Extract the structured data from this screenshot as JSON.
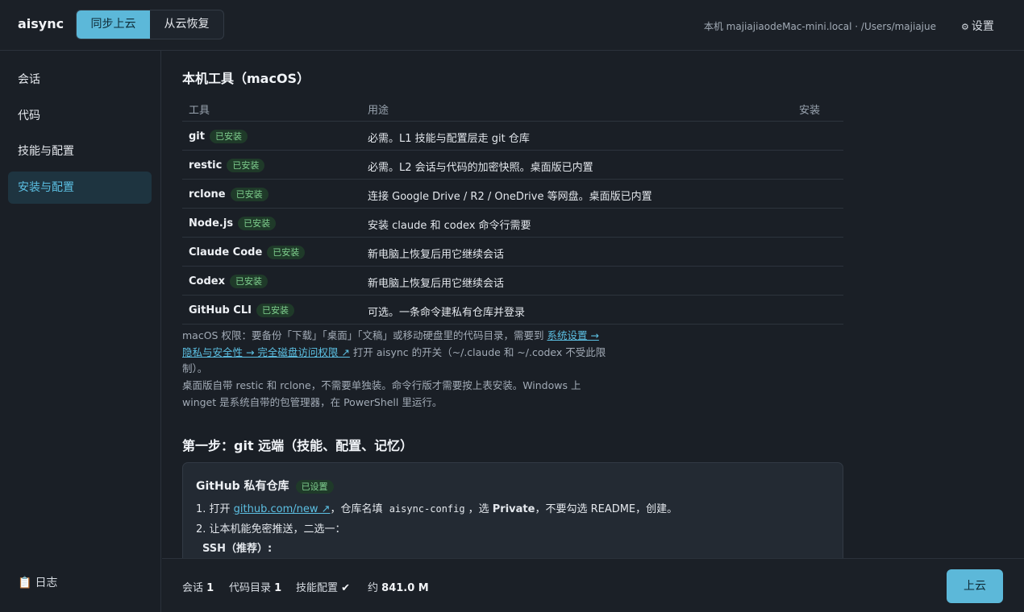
{
  "header": {
    "logo": "aisync",
    "tabs": [
      "同步上云",
      "从云恢复"
    ],
    "machine": "本机 majiajiaodeMac-mini.local · /Users/majiajue",
    "settings_icon": "⚙",
    "settings_label": "设置"
  },
  "sidebar": {
    "items": [
      "会话",
      "代码",
      "技能与配置",
      "安装与配置"
    ],
    "log_icon": "📋",
    "log_label": "日志"
  },
  "main": {
    "section1_title": "本机工具（macOS）",
    "table": {
      "headers": [
        "工具",
        "用途",
        "安装"
      ],
      "badge": "已安装",
      "rows": [
        {
          "name": "git",
          "desc": "必需。L1 技能与配置层走 git 仓库"
        },
        {
          "name": "restic",
          "desc": "必需。L2 会话与代码的加密快照。桌面版已内置"
        },
        {
          "name": "rclone",
          "desc": "连接 Google Drive / R2 / OneDrive 等网盘。桌面版已内置"
        },
        {
          "name": "Node.js",
          "desc": "安装 claude 和 codex 命令行需要"
        },
        {
          "name": "Claude Code",
          "desc": "新电脑上恢复后用它继续会话"
        },
        {
          "name": "Codex",
          "desc": "新电脑上恢复后用它继续会话"
        },
        {
          "name": "GitHub CLI",
          "desc": "可选。一条命令建私有仓库并登录"
        }
      ]
    },
    "note1": {
      "prefix": "macOS 权限：要备份「下载」「桌面」「文稿」或移动硬盘里的代码目录，需要到 ",
      "link1": "系统设置 →",
      "link2": "隐私与安全性 → 完全磁盘访问权限 ↗",
      "suffix1": " 打开 aisync 的开关（~/.claude 和 ~/.codex 不受此限",
      "suffix2": "制）。"
    },
    "note2": {
      "line1": "桌面版自带 restic 和 rclone，不需要单独装。命令行版才需要按上表安装。Windows 上",
      "line2": "winget 是系统自带的包管理器，在 PowerShell 里运行。"
    },
    "section2_title": "第一步：git 远端（技能、配置、记忆）",
    "card": {
      "title": "GitHub 私有仓库",
      "badge": "已设置",
      "step1_prefix": "1. 打开 ",
      "step1_link": "github.com/new ↗",
      "step1_mid": "，仓库名填 ",
      "step1_code": "aisync-config",
      "step1_mid2": "，选 ",
      "step1_bold": "Private",
      "step1_suffix": "，不要勾选 README，创建。",
      "step2": "2. 让本机能免密推送，二选一：",
      "ssh": "SSH（推荐）:"
    }
  },
  "footer": {
    "sessions_label": "会话",
    "sessions_count": "1",
    "code_label": "代码目录",
    "code_count": "1",
    "skills_label": "技能配置",
    "skills_check": "✔",
    "size_label": "约",
    "size_value": "841.0 M",
    "upload_label": "上云"
  },
  "colors": {
    "accent": "#5cb8d9",
    "background": "#1a1f26",
    "badge_green": "#7fcf8e",
    "link": "#5cc0e3"
  }
}
